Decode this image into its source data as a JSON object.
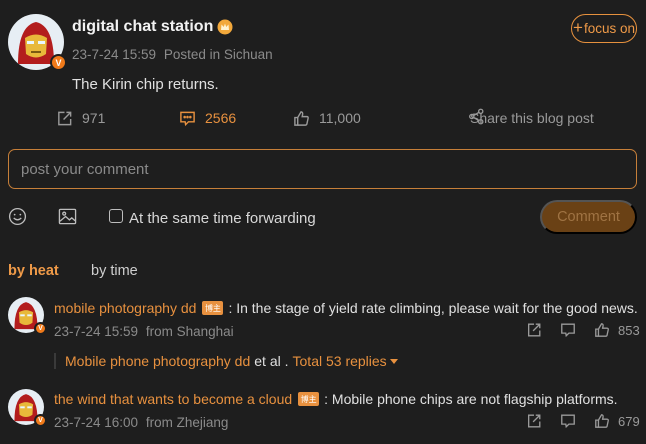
{
  "post": {
    "author": "digital chat station",
    "timestamp": "23-7-24 15:59",
    "location": "Posted in Sichuan",
    "text": "The Kirin chip returns.",
    "follow_label": "focus on",
    "follow_symbol": "+",
    "verified_badge": "V",
    "actions": {
      "reposts": "971",
      "comments": "2566",
      "likes": "11,000",
      "share_label": "Share this blog post"
    }
  },
  "composer": {
    "placeholder": "post your comment",
    "forward_label": "At the same time forwarding",
    "forward_checked": false,
    "submit_label": "Comment"
  },
  "sort": {
    "heat_label": "by heat",
    "time_label": "by time"
  },
  "comments": [
    {
      "author": "mobile photography dd",
      "tag": "博主",
      "text": ": In the stage of yield rate climbing, please wait for the good news.",
      "timestamp": "23-7-24 15:59",
      "location": "from Shanghai",
      "likes": "853",
      "replies": {
        "names": "Mobile phone photography dd",
        "middle": "et al .",
        "total": "Total 53 replies"
      }
    },
    {
      "author": "the wind that wants to become a cloud",
      "tag": "博主",
      "text": ": Mobile phone chips are not flagship platforms.",
      "timestamp": "23-7-24 16:00",
      "location": "from Zhejiang",
      "likes": "679"
    }
  ],
  "colors": {
    "background": "#1e1e1e",
    "accent": "#e8913f",
    "muted": "#8b8b8b",
    "submit_bg": "#6a4115"
  }
}
